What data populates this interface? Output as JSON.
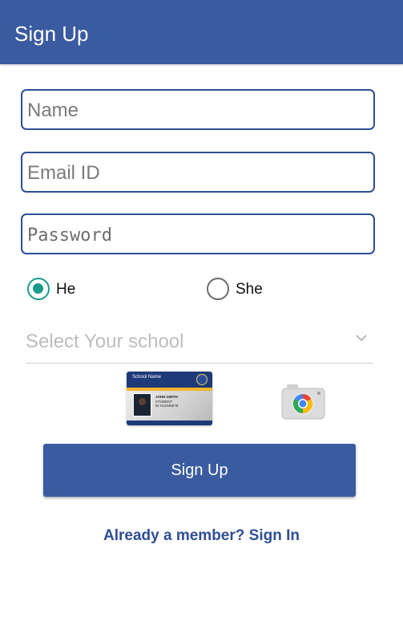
{
  "app_bar": {
    "title": "Sign Up",
    "color": "#3A5BA0"
  },
  "form": {
    "name_placeholder": "Name",
    "email_placeholder": "Email ID",
    "password_placeholder": "Password",
    "gender": {
      "options": [
        {
          "label": "He",
          "selected": true
        },
        {
          "label": "She",
          "selected": false
        }
      ]
    },
    "school_select_placeholder": "Select Your school",
    "id_card": {
      "school_name": "School Name",
      "student_name": "JOHN SMITH",
      "role": "STUDENT",
      "id": "ID #12345678"
    },
    "camera_icon": "camera-icon",
    "submit_label": "Sign Up",
    "signin_link": "Already a member? Sign In"
  },
  "colors": {
    "primary": "#3A5BA0",
    "radio_accent": "#1A9B8C"
  }
}
